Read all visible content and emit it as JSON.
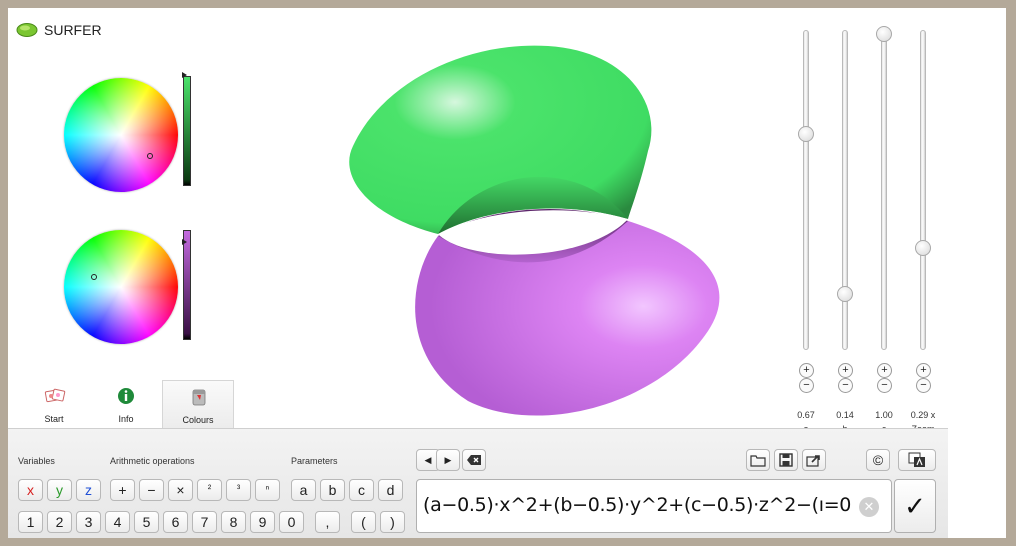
{
  "app": {
    "title": "SURFER",
    "logo_icon": "lime-logo-icon"
  },
  "colors": {
    "outside_surface": "#4be36b",
    "inside_surface": "#c46be0",
    "frame": "#b4a999"
  },
  "tabs": [
    {
      "label": "Start",
      "icon": "start-icon",
      "active": false
    },
    {
      "label": "Info",
      "icon": "info-icon",
      "active": false
    },
    {
      "label": "Colours",
      "icon": "paint-bucket-icon",
      "active": true
    }
  ],
  "sliders": [
    {
      "value_label": "0.67",
      "name": "a",
      "level": 0.67
    },
    {
      "value_label": "0.14",
      "name": "b",
      "level": 0.14
    },
    {
      "value_label": "1.00",
      "name": "c",
      "level": 1.0
    },
    {
      "value_label": "0.29 x",
      "name": "Zoom",
      "level": 0.29
    }
  ],
  "keyboard": {
    "variables_label": "Variables",
    "arithmetic_label": "Arithmetic operations",
    "parameters_label": "Parameters",
    "variables": [
      "x",
      "y",
      "z"
    ],
    "operations": [
      "+",
      "−",
      "×",
      "²",
      "³",
      "ⁿ"
    ],
    "parameters": [
      "a",
      "b",
      "c",
      "d"
    ],
    "digits": [
      "1",
      "2",
      "3",
      "4",
      "5",
      "6",
      "7",
      "8",
      "9",
      "0"
    ],
    "punctuation": [
      ",",
      "(",
      ")"
    ]
  },
  "formula": {
    "text": "(a−0.5)·x^2+(b−0.5)·y^2+(c−0.5)·z^2−(ı=0"
  },
  "toolbar": {
    "left_arrow": "◀",
    "right_arrow": "▶",
    "confirm": "✓",
    "copyright": "©"
  }
}
